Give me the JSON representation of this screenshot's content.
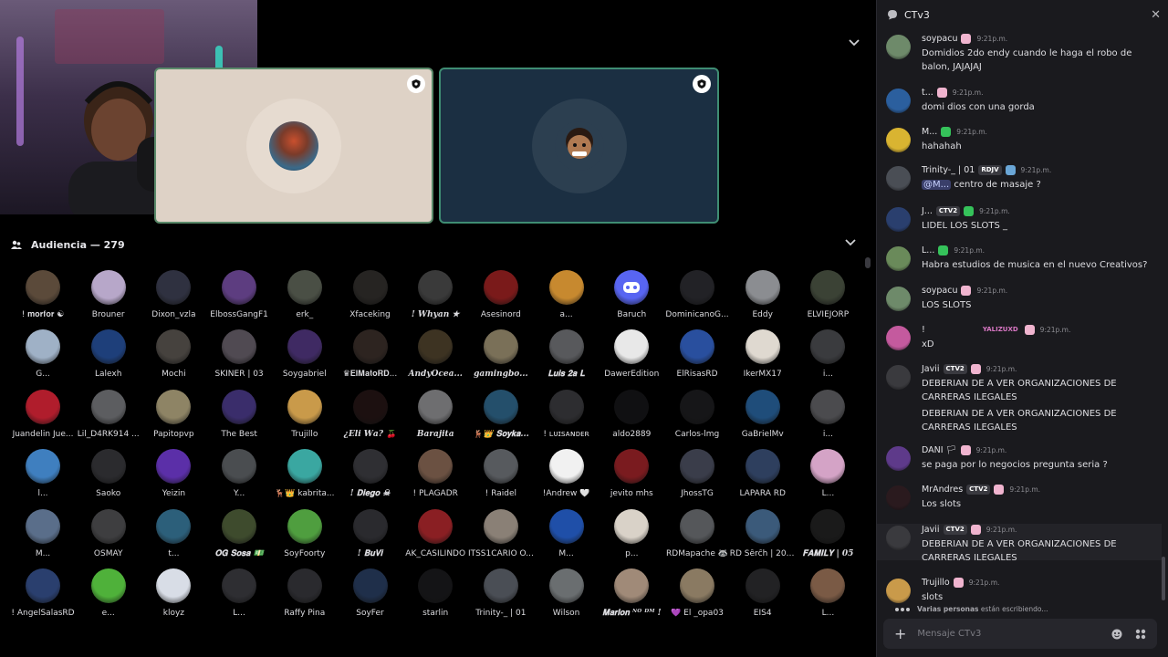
{
  "stage": {
    "collapse_icon": "chevron-down-icon"
  },
  "audience": {
    "label": "Audiencia — 279",
    "icon": "audience-icon",
    "members": [
      {
        "name": "! 𝐦𝐨𝐫𝐟𝐨𝐫 ☯",
        "color": "#5b4a3a",
        "bold": false
      },
      {
        "name": "Brouner",
        "color": "#b7a7c9",
        "bold": false
      },
      {
        "name": "Dixon_vzla",
        "color": "#2f3140",
        "bold": false
      },
      {
        "name": "ElbossGangF1",
        "color": "#5d3d80",
        "bold": false
      },
      {
        "name": "erk_",
        "color": "#4a4f45",
        "bold": false
      },
      {
        "name": "Xfaceking",
        "color": "#262422",
        "bold": false
      },
      {
        "name": "! 𝑾𝒉𝒚𝒂𝒏 ★",
        "color": "#3a3a3a",
        "bold": true
      },
      {
        "name": "Asesinord",
        "color": "#7a1a1a",
        "bold": false
      },
      {
        "name": "a...",
        "color": "#c7892f",
        "bold": false
      },
      {
        "name": "Baruch",
        "color": "#5865f2",
        "bold": false
      },
      {
        "name": "DominicanoG...",
        "color": "#222226",
        "bold": false
      },
      {
        "name": "Eddy",
        "color": "#8b8d91",
        "bold": false
      },
      {
        "name": "ELVIEJORP",
        "color": "#3b4235",
        "bold": false
      },
      {
        "name": "G...",
        "color": "#9fb1c6",
        "bold": false
      },
      {
        "name": "Lalexh",
        "color": "#1e3f7a",
        "bold": false
      },
      {
        "name": "Mochi",
        "color": "#46423e",
        "bold": false
      },
      {
        "name": "SKINER | 03",
        "color": "#504a52",
        "bold": false
      },
      {
        "name": "Soygabriel",
        "color": "#3f2a63",
        "bold": false
      },
      {
        "name": "♛𝐄𝐥𝐌𝐚𝐭𝐨𝐑𝐃...",
        "color": "#2d2420",
        "bold": false
      },
      {
        "name": "𝑨𝒏𝒅𝒚𝑶𝒄𝒆𝒂...",
        "color": "#3d3322",
        "bold": true
      },
      {
        "name": "𝒈𝒂𝒎𝒊𝒏𝒈𝒃𝒐...",
        "color": "#7a7058",
        "bold": true
      },
      {
        "name": "𝐋𝐮𝐢𝐬 𝟐𝐚 𝐋",
        "color": "#58595c",
        "bold": true
      },
      {
        "name": "DawerEdition",
        "color": "#e8e8e8",
        "bold": false
      },
      {
        "name": "ElRisasRD",
        "color": "#294f9e",
        "bold": false
      },
      {
        "name": "IkerMX17",
        "color": "#dfd9d0",
        "bold": false
      },
      {
        "name": "i...",
        "color": "#3a3b3e",
        "bold": false
      },
      {
        "name": "Juandelin Jue...",
        "color": "#b01d2c",
        "bold": false
      },
      {
        "name": "Lil_D4RK914 ...",
        "color": "#5c5d60",
        "bold": false
      },
      {
        "name": "Papitopvp",
        "color": "#8e8465",
        "bold": false
      },
      {
        "name": "The Best",
        "color": "#3a2d6b",
        "bold": false
      },
      {
        "name": "Trujillo",
        "color": "#c99a4a",
        "bold": false
      },
      {
        "name": "¿𝑬𝒍𝒊 𝑾𝒂? 🍒",
        "color": "#1c1010",
        "bold": true
      },
      {
        "name": "Barajita",
        "color": "#6e6e70",
        "bold": true
      },
      {
        "name": "🦌👑 𝐒𝐨𝐲𝐤𝐚...",
        "color": "#244f6b",
        "bold": true
      },
      {
        "name": "! ʟᴜɪsᴀɴᴅᴇʀ",
        "color": "#2d2d30",
        "bold": false
      },
      {
        "name": "aldo2889",
        "color": "#101012",
        "bold": false
      },
      {
        "name": "Carlos-lmg",
        "color": "#161618",
        "bold": false
      },
      {
        "name": "GaBrielMv",
        "color": "#1f4d7a",
        "bold": false
      },
      {
        "name": "i...",
        "color": "#4b4b4e",
        "bold": false
      },
      {
        "name": "l...",
        "color": "#3f7fbf",
        "bold": false
      },
      {
        "name": "Saoko",
        "color": "#2b2b2e",
        "bold": false
      },
      {
        "name": "Yeizin",
        "color": "#5b2fa8",
        "bold": false
      },
      {
        "name": "Y...",
        "color": "#4a4d50",
        "bold": false
      },
      {
        "name": "🦌👑 kabrita...",
        "color": "#3aa7a1",
        "bold": false
      },
      {
        "name": "! 𝐃𝐢𝐞𝐠𝐨 ☠",
        "color": "#2f2f33",
        "bold": true
      },
      {
        "name": "! PLAGADR",
        "color": "#6b5142",
        "bold": false
      },
      {
        "name": "! Raidel",
        "color": "#575a5e",
        "bold": false
      },
      {
        "name": "!Andrew 🤍",
        "color": "#f1f1f1",
        "bold": false
      },
      {
        "name": "jevito mhs",
        "color": "#7a1b1f",
        "bold": false
      },
      {
        "name": "JhossTG",
        "color": "#3a3d4a",
        "bold": false
      },
      {
        "name": "LAPARA RD",
        "color": "#2e3f5e",
        "bold": false
      },
      {
        "name": "L...",
        "color": "#d4a3c6",
        "bold": false
      },
      {
        "name": "M...",
        "color": "#5a6e8a",
        "bold": false
      },
      {
        "name": "OSMAY",
        "color": "#3e3e40",
        "bold": false
      },
      {
        "name": "t...",
        "color": "#2c5f7a",
        "bold": false
      },
      {
        "name": "𝐎𝐆 𝐒𝐨𝐬𝐚 💵",
        "color": "#3e4b2d",
        "bold": true
      },
      {
        "name": "SoyFoorty",
        "color": "#4f9e3f",
        "bold": false
      },
      {
        "name": "! 𝐁𝐮𝐕𝐢",
        "color": "#2a2a2e",
        "bold": true
      },
      {
        "name": "AK_CASILINDO",
        "color": "#8a1f23",
        "bold": false
      },
      {
        "name": "ITSS1CARIO O...",
        "color": "#8a8076",
        "bold": false
      },
      {
        "name": "M...",
        "color": "#1f4fa8",
        "bold": false
      },
      {
        "name": "p...",
        "color": "#d9d2c8",
        "bold": false
      },
      {
        "name": "RDMapache 🦝",
        "color": "#55575a",
        "bold": false
      },
      {
        "name": "RD Ŝêrĉĥ | 20 ...",
        "color": "#3b5a7a",
        "bold": false
      },
      {
        "name": "𝐅𝐀𝐌𝐈𝐋𝐘 | 05",
        "color": "#1a1a1a",
        "bold": true
      },
      {
        "name": "! AngelSalasRD",
        "color": "#2a3f6e",
        "bold": false
      },
      {
        "name": "e...",
        "color": "#4fb13a",
        "bold": false
      },
      {
        "name": "kloyz",
        "color": "#d8dde6",
        "bold": false
      },
      {
        "name": "L...",
        "color": "#2e2e32",
        "bold": false
      },
      {
        "name": "Raffy Pina",
        "color": "#2a2a2e",
        "bold": false
      },
      {
        "name": "SoyFer",
        "color": "#1f2f4a",
        "bold": false
      },
      {
        "name": "starlin",
        "color": "#141416",
        "bold": false
      },
      {
        "name": "Trinity-_ | 01",
        "color": "#4a4e55",
        "bold": false
      },
      {
        "name": "Wilson",
        "color": "#6a6e70",
        "bold": false
      },
      {
        "name": "𝐌𝐚𝐫𝐥𝐨𝐧 ᴺᴼ ᴰᴹ !",
        "color": "#a08a78",
        "bold": true
      },
      {
        "name": "💜 El _opa03",
        "color": "#8a7a62",
        "bold": false
      },
      {
        "name": "EIS4",
        "color": "#222224",
        "bold": false
      },
      {
        "name": "L...",
        "color": "#7a5a45",
        "bold": false
      }
    ]
  },
  "chat": {
    "title": "CTv3",
    "icon": "chat-bubble-icon",
    "close_icon": "close-icon",
    "messages": [
      {
        "user": "soypacu",
        "time": "9:21p.m.",
        "text": "Domidios 2do endy cuando le haga el robo de balon, JAJAJAJ",
        "color": "#6e8a6a",
        "ufont": "normal"
      },
      {
        "user": "t...",
        "time": "9:21p.m.",
        "text": "domi dios con una gorda",
        "color": "#2b5f9e",
        "ufont": "normal"
      },
      {
        "user": "M...",
        "time": "9:21p.m.",
        "text": "hahahah",
        "color": "#d9b431",
        "ufont": "normal"
      },
      {
        "user": "Trinity-_ | 01",
        "badge": "RDJV",
        "time": "9:21p.m.",
        "mention": "@M...",
        "text": "centro de masaje ?",
        "color": "#4a4e55"
      },
      {
        "user": "J...",
        "badge": "CTV2",
        "time": "9:21p.m.",
        "text": "LIDEL LOS SLOTS _",
        "color": "#2a3f6e"
      },
      {
        "user": "L...",
        "time": "9:21p.m.",
        "text": "Habra estudios de musica en el nuevo Creativos?",
        "color": "#6a8a5a"
      },
      {
        "user": "soypacu",
        "time": "9:21p.m.",
        "text": "LOS SLOTS",
        "color": "#6e8a6a"
      },
      {
        "user": "!",
        "badge_text": "YALIZUXD",
        "time": "9:21p.m.",
        "text": "xD",
        "color": "#c45a9e"
      },
      {
        "user": "Javii",
        "badge": "CTV2",
        "time": "9:21p.m.",
        "text": "DEBERIAN DE A VER ORGANIZACIONES  DE CARRERAS ILEGALES",
        "text2": "DEBERIAN DE A VER ORGANIZACIONES  DE CARRERAS ILEGALES",
        "color": "#3a3a3e"
      },
      {
        "user": "DANI 🏳",
        "time": "9:21p.m.",
        "text": "se paga por lo negocios pregunta seria ?",
        "color": "#5e3a8a"
      },
      {
        "user": "MrAndres",
        "badge": "CTV2",
        "time": "9:21p.m.",
        "text": "Los slots",
        "color": "#2a1a1e"
      },
      {
        "user": "Javii",
        "badge": "CTV2",
        "time": "9:21p.m.",
        "text": "DEBERIAN DE A VER ORGANIZACIONES  DE CARRERAS ILEGALES",
        "color": "#3a3a3e"
      },
      {
        "user": "Trujillo",
        "time": "9:21p.m.",
        "text": "slots",
        "color": "#c99a4a"
      }
    ],
    "typing": "Varias personas están escribiendo...",
    "composer_placeholder": "Mensaje CTv3",
    "plus_icon": "plus-icon",
    "emoji_icon": "emoji-icon",
    "apps_icon": "apps-icon"
  }
}
